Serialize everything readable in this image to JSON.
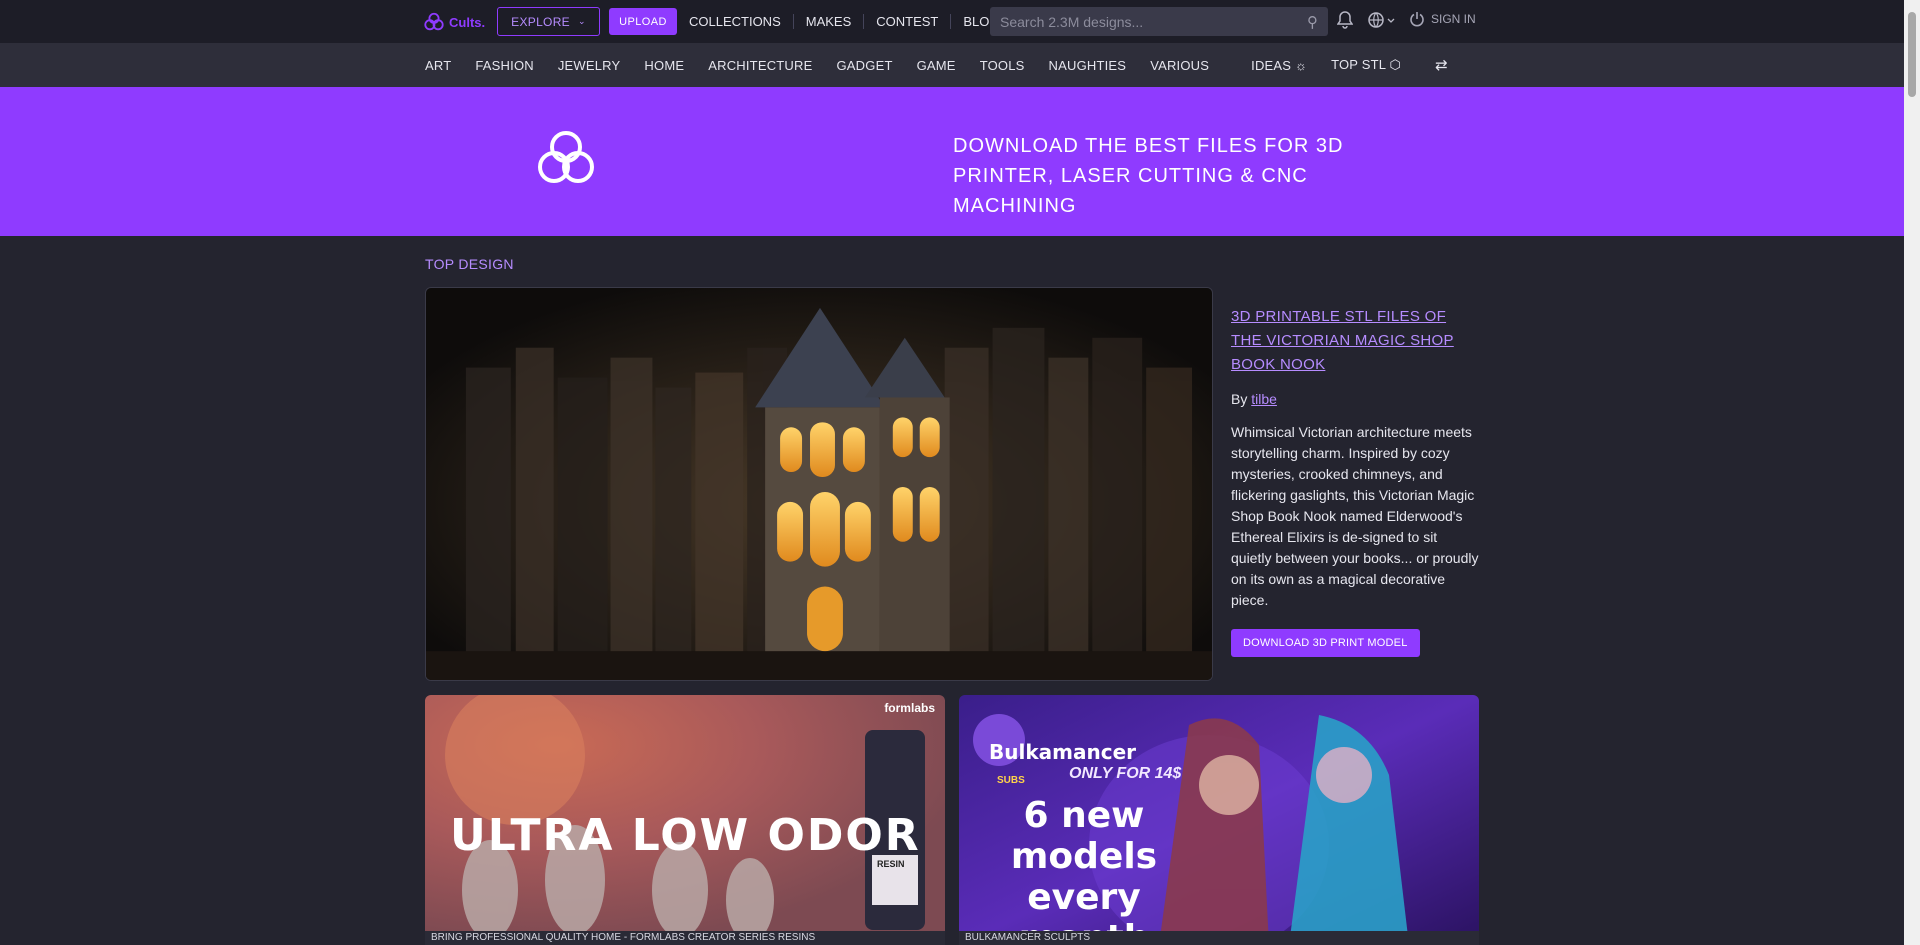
{
  "header": {
    "logo_text": "Cults.",
    "explore_label": "EXPLORE",
    "upload_label": "UPLOAD",
    "nav": [
      "COLLECTIONS",
      "MAKES",
      "CONTEST",
      "BLOG"
    ],
    "search_placeholder": "Search 2.3M designs...",
    "signin_label": "SIGN IN"
  },
  "categories": {
    "items": [
      "ART",
      "FASHION",
      "JEWELRY",
      "HOME",
      "ARCHITECTURE",
      "GADGET",
      "GAME",
      "TOOLS",
      "NAUGHTIES",
      "VARIOUS"
    ],
    "ideas_label": "IDEAS",
    "topstl_label": "TOP STL"
  },
  "hero": {
    "line1": "DOWNLOAD THE BEST FILES FOR 3D",
    "line2": "PRINTER, LASER CUTTING & CNC MACHINING"
  },
  "top_design": {
    "section_title": "TOP DESIGN",
    "title": "3D PRINTABLE STL FILES OF THE VICTORIAN MAGIC SHOP BOOK NOOK",
    "by_label": "By",
    "author": "tilbe",
    "description": "Whimsical Victorian architecture meets storytelling charm. Inspired by cozy mysteries, crooked chimneys, and flickering gaslights, this Victorian Magic Shop Book Nook named Elderwood's Ethereal Elixirs is de-signed to sit quietly between your books... or proudly on its own as a magical decorative piece.",
    "download_label": "DOWNLOAD 3D PRINT MODEL"
  },
  "ads": [
    {
      "brand": "formlabs",
      "headline": "ULTRA LOW ODOR",
      "caption": "BRING PROFESSIONAL QUALITY HOME - FORMLABS CREATOR SERIES RESINS",
      "label": "RESIN"
    },
    {
      "brand": "Bulkamancer",
      "badge": "ONLY FOR 14$",
      "sub": "SUBS",
      "headline_lines": [
        "6 new",
        "models",
        "every",
        "month"
      ],
      "caption": "BULKAMANCER SCULPTS"
    }
  ],
  "colors": {
    "accent": "#8f3bff",
    "accent_light": "#b68cff",
    "background": "#24242f"
  }
}
